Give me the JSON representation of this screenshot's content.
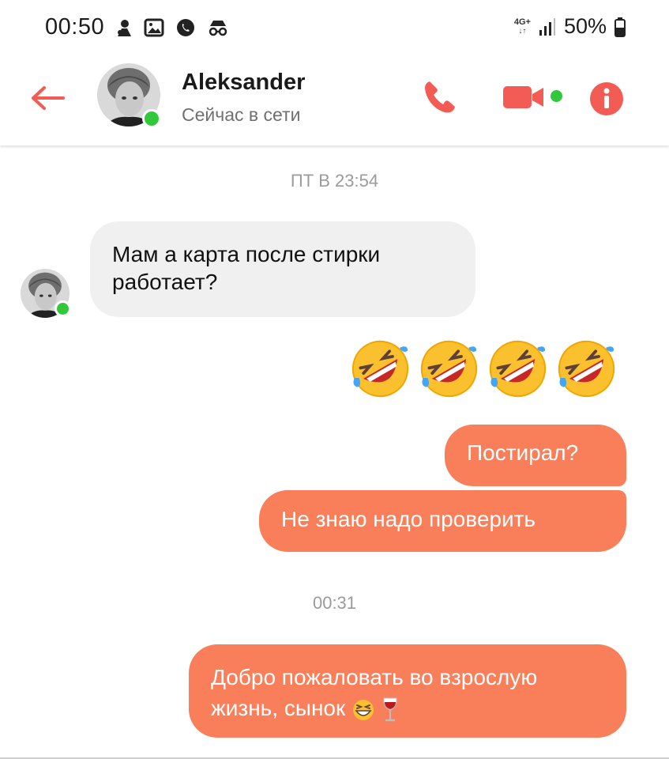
{
  "status_bar": {
    "time": "00:50",
    "network": "4G+",
    "battery": "50%"
  },
  "header": {
    "contact_name": "Aleksander",
    "contact_status": "Сейчас в сети"
  },
  "messages": {
    "timestamp_1": "ПТ В 23:54",
    "incoming_1": "Мам а карта после стирки работает?",
    "outgoing_emoji_count": 4,
    "outgoing_1": "Постирал?",
    "outgoing_2": "Не знаю надо проверить",
    "timestamp_2": "00:31",
    "outgoing_3": "Добро пожаловать во взрослую жизнь, сынок"
  },
  "colors": {
    "accent": "#f25c54",
    "outgoing_bubble": "#f87f5a",
    "incoming_bubble": "#f0f0f0",
    "online": "#31c93b"
  },
  "icons": [
    "back-arrow-icon",
    "phone-icon",
    "video-call-icon",
    "info-icon",
    "rolling-laughing-emoji",
    "grinning-squint-emoji",
    "wine-glass-emoji"
  ]
}
